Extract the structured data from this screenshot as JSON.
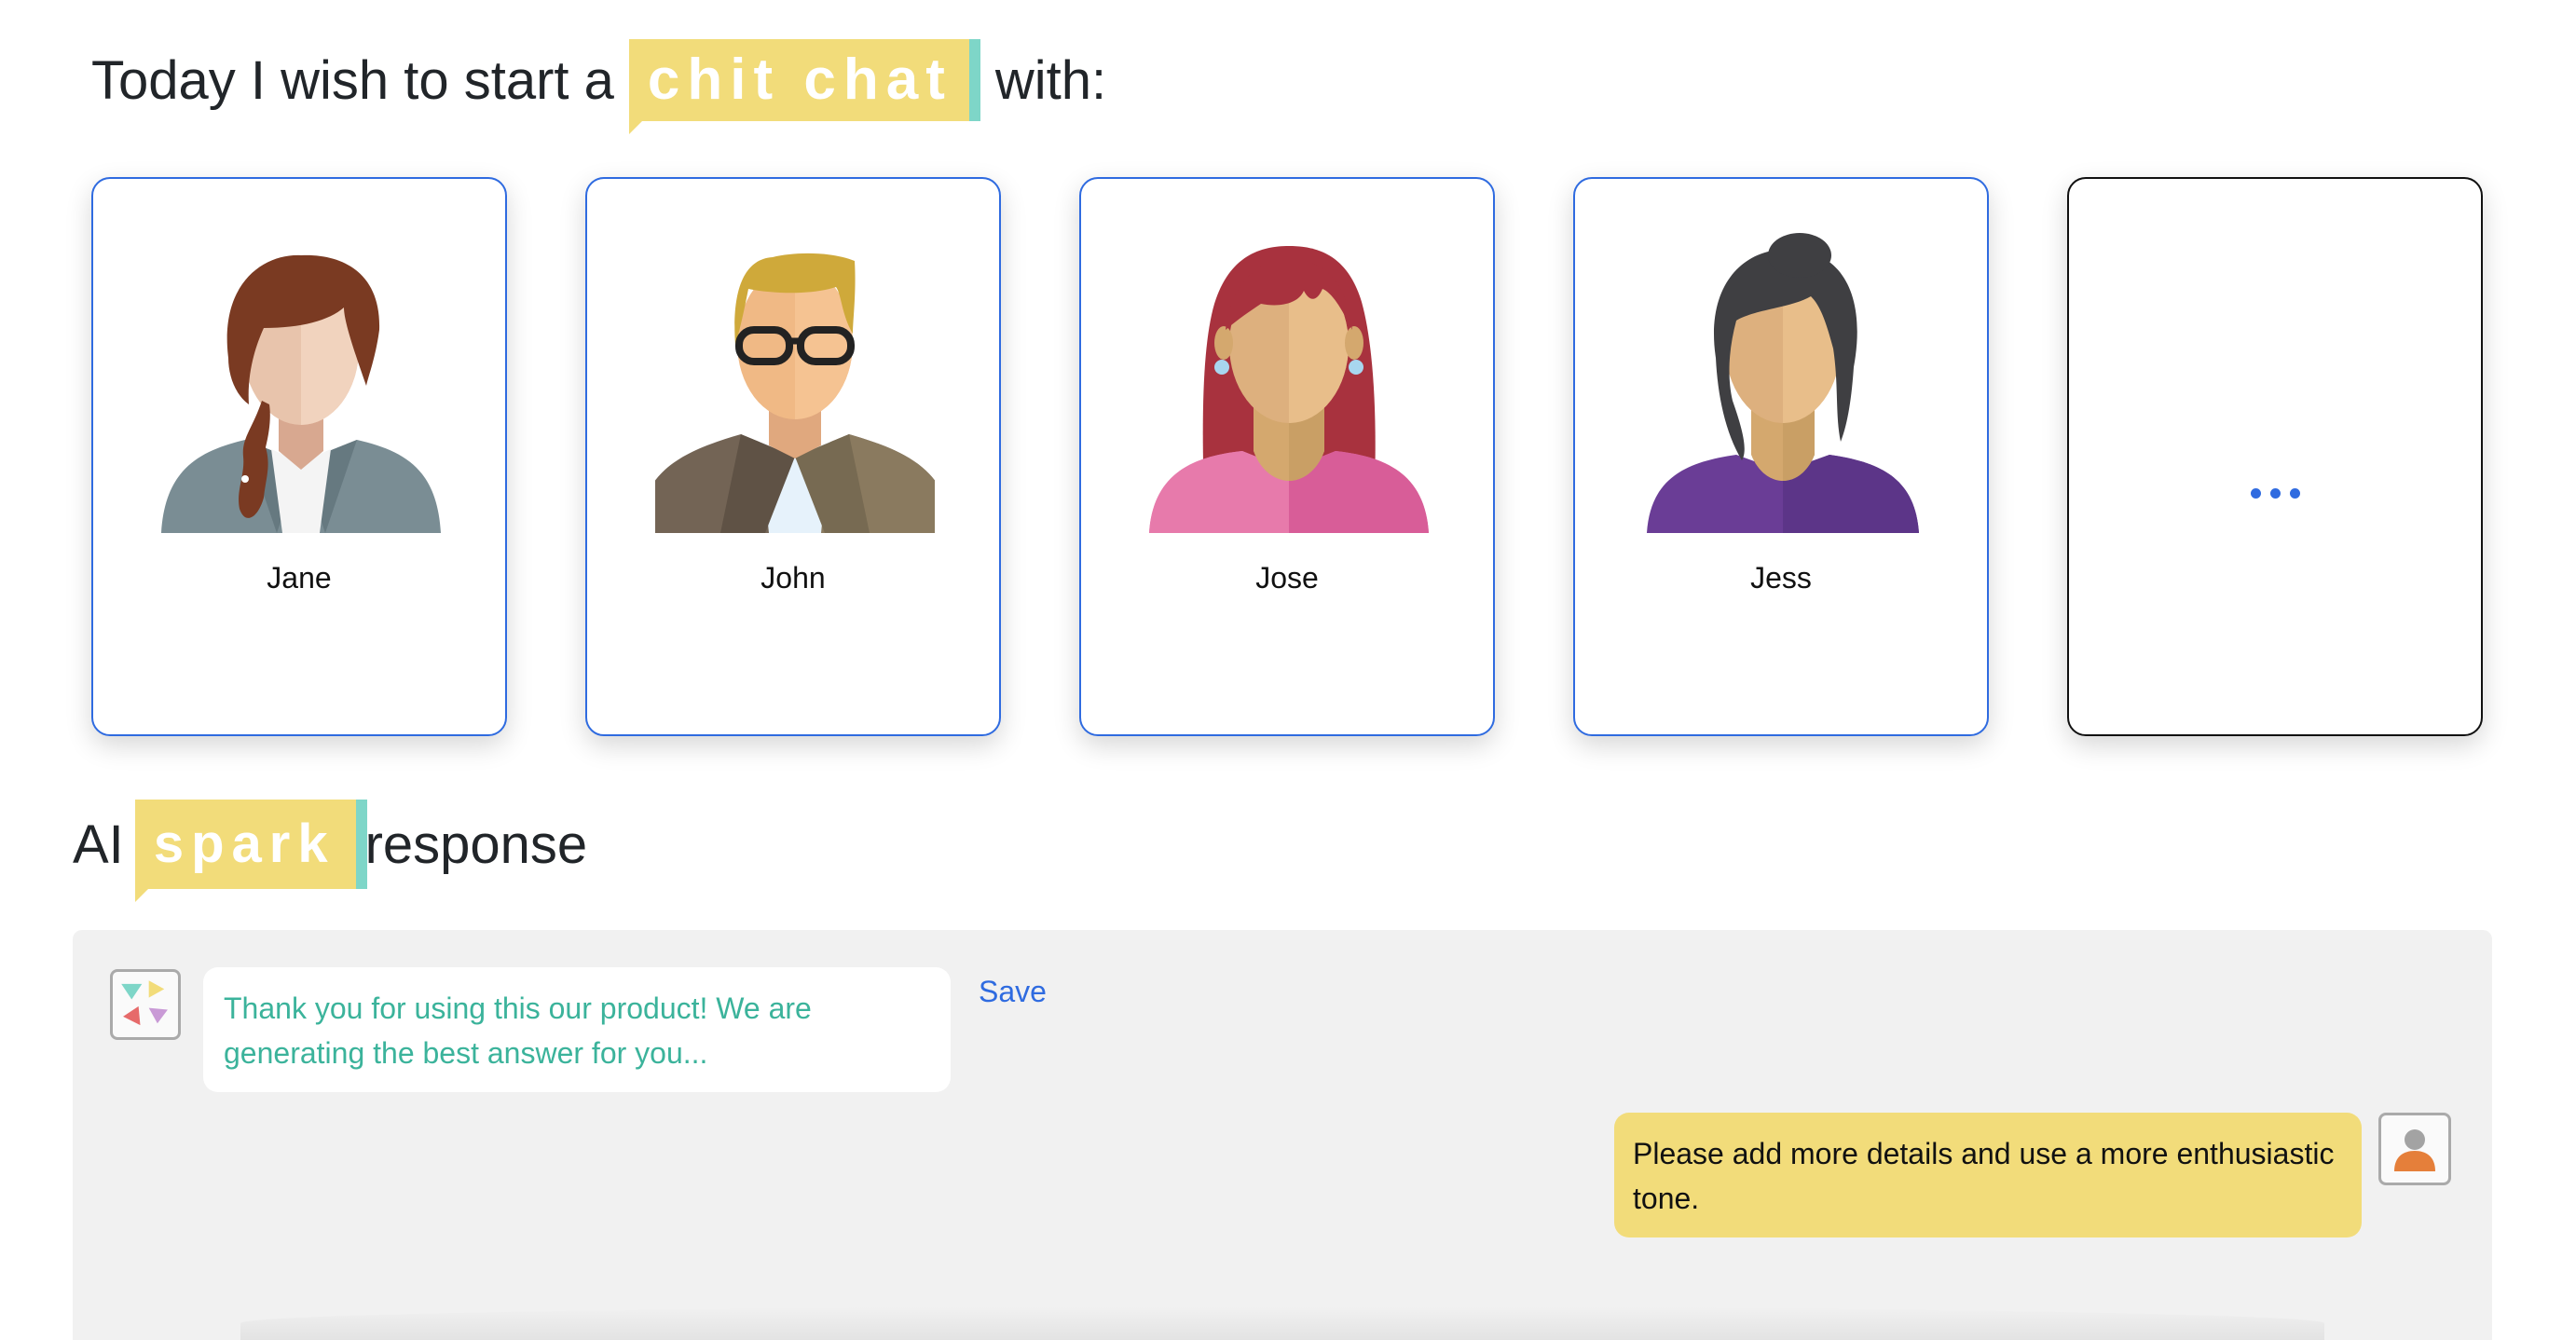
{
  "header": {
    "prefix": "Today I wish to start a",
    "tag": "chit chat",
    "suffix": "with:"
  },
  "characters": [
    {
      "name": "Jane",
      "icon": "woman-braid-avatar-icon"
    },
    {
      "name": "John",
      "icon": "man-glasses-avatar-icon"
    },
    {
      "name": "Jose",
      "icon": "woman-red-hair-avatar-icon"
    },
    {
      "name": "Jess",
      "icon": "woman-dark-hair-avatar-icon"
    }
  ],
  "more_card": {
    "icon": "ellipsis-icon"
  },
  "response_heading": {
    "prefix": "AI",
    "tag": "spark",
    "suffix": "response"
  },
  "chat": {
    "bot_message": "Thank you for using this our product! We are generating the best answer for you...",
    "save_label": "Save",
    "user_message": "Please add more details and use a more enthusiastic tone."
  },
  "colors": {
    "accent_blue": "#2f6be0",
    "tag_yellow": "#f2dc7a",
    "tag_teal": "#7ed6c8",
    "bot_text": "#3bb39b",
    "panel_bg": "#f1f1f1"
  }
}
